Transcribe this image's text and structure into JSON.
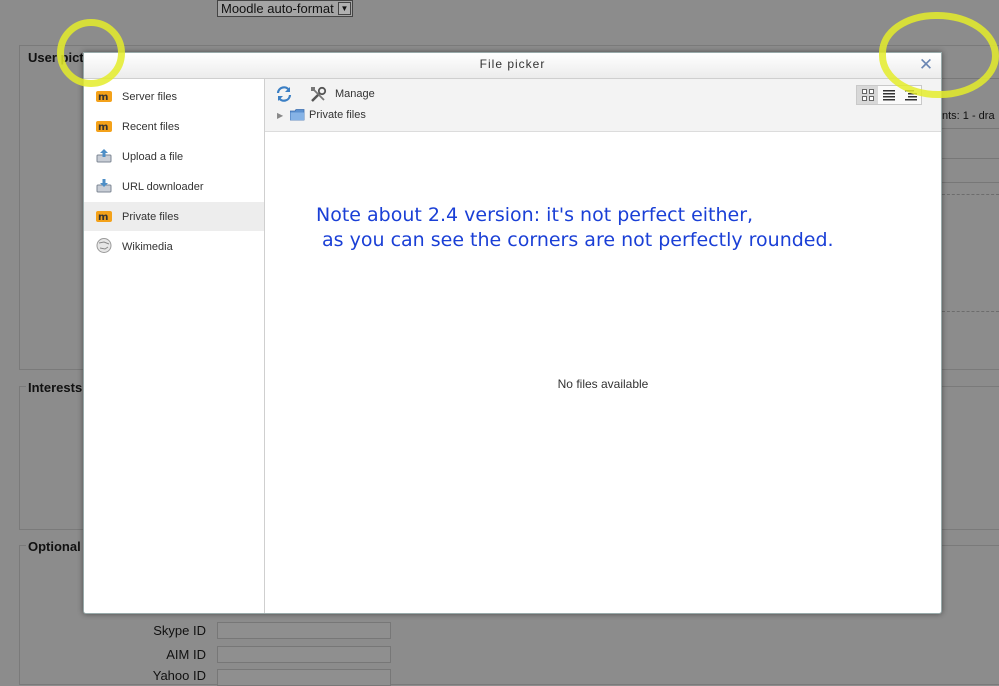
{
  "background": {
    "text_format_select": "Moodle auto-format",
    "legend_user_picture": "User pict",
    "legend_interests": "Interests",
    "legend_optional": "Optional",
    "right_fragment": "nts: 1 - dra",
    "fields": [
      {
        "label": "Skype ID"
      },
      {
        "label": "AIM ID"
      },
      {
        "label": "Yahoo ID"
      }
    ]
  },
  "dialog": {
    "title": "File picker",
    "close_icon": "close-icon",
    "repositories": [
      {
        "label": "Server files",
        "icon": "moodle-icon"
      },
      {
        "label": "Recent files",
        "icon": "moodle-icon"
      },
      {
        "label": "Upload a file",
        "icon": "upload-icon"
      },
      {
        "label": "URL downloader",
        "icon": "download-icon"
      },
      {
        "label": "Private files",
        "icon": "moodle-icon",
        "active": true
      },
      {
        "label": "Wikimedia",
        "icon": "wikimedia-icon"
      }
    ],
    "toolbar": {
      "manage_label": "Manage",
      "path_label": "Private files"
    },
    "view_modes": [
      "icons-view",
      "list-view",
      "tree-view"
    ],
    "active_view": "icons-view",
    "empty_message": "No files available"
  },
  "annotation": {
    "note_line1": "Note about 2.4 version: it's not perfect either,",
    "note_line2": " as you can see the corners are not perfectly rounded.",
    "color": "#1a3fd6",
    "highlight_color": "#e4ec2a"
  }
}
